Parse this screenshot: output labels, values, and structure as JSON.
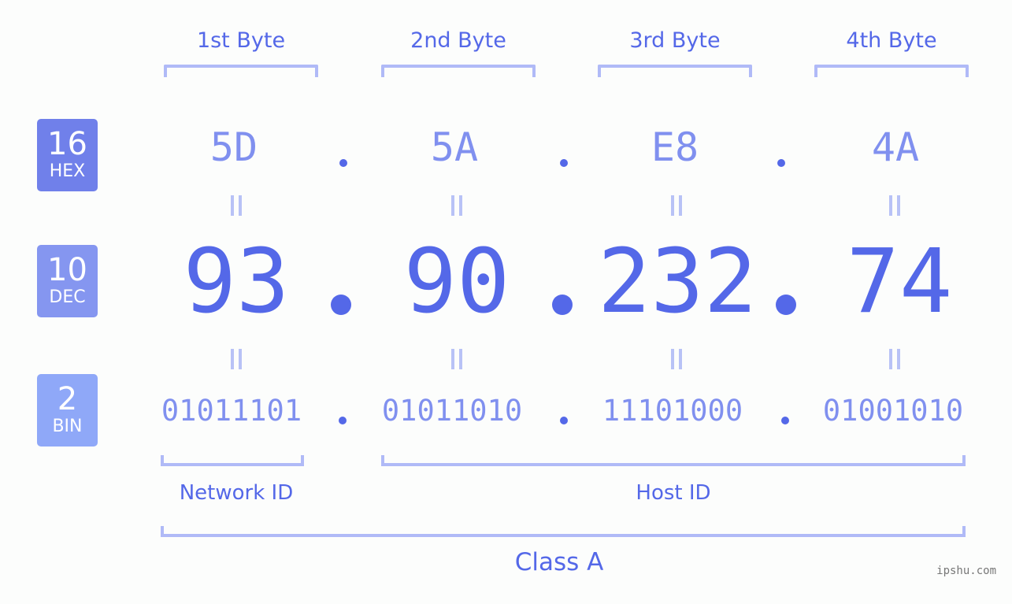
{
  "badges": [
    {
      "base": "16",
      "label": "HEX",
      "color": "#7080ea"
    },
    {
      "base": "10",
      "label": "DEC",
      "color": "#8596f0"
    },
    {
      "base": "2",
      "label": "BIN",
      "color": "#8fa8f8"
    }
  ],
  "bytes": [
    {
      "header": "1st Byte",
      "hex": "5D",
      "dec": "93",
      "bin": "01011101"
    },
    {
      "header": "2nd Byte",
      "hex": "5A",
      "dec": "90",
      "bin": "01011010"
    },
    {
      "header": "3rd Byte",
      "hex": "E8",
      "dec": "232",
      "bin": "11101000"
    },
    {
      "header": "4th Byte",
      "hex": "4A",
      "dec": "74",
      "bin": "01001010"
    }
  ],
  "segments": {
    "network": "Network ID",
    "host": "Host ID",
    "class": "Class A"
  },
  "watermark": "ipshu.com",
  "colors": {
    "accent": "#5468e8",
    "light_accent": "#8090ef",
    "bracket": "#b0baf7"
  }
}
